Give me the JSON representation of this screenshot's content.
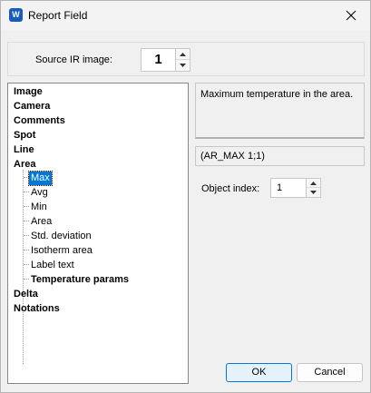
{
  "window": {
    "title": "Report Field",
    "app_icon_letter": "W",
    "icons": {
      "app": "word-app-icon",
      "close": "close-icon"
    }
  },
  "source": {
    "label": "Source IR image:",
    "value": "1"
  },
  "tree": {
    "items": [
      {
        "label": "Image",
        "bold": true
      },
      {
        "label": "Camera",
        "bold": true
      },
      {
        "label": "Comments",
        "bold": true
      },
      {
        "label": "Spot",
        "bold": true
      },
      {
        "label": "Line",
        "bold": true
      },
      {
        "label": "Area",
        "bold": true
      },
      {
        "label": "Max",
        "bold": false,
        "selected": true
      },
      {
        "label": "Avg",
        "bold": false
      },
      {
        "label": "Min",
        "bold": false
      },
      {
        "label": "Area",
        "bold": false
      },
      {
        "label": "Std. deviation",
        "bold": false
      },
      {
        "label": "Isotherm area",
        "bold": false
      },
      {
        "label": "Label text",
        "bold": false
      },
      {
        "label": "Temperature params",
        "bold": true
      },
      {
        "label": "Delta",
        "bold": true
      },
      {
        "label": "Notations",
        "bold": true
      }
    ]
  },
  "details": {
    "description": "Maximum temperature in the area.",
    "formula": "(AR_MAX 1;1)",
    "object_index_label": "Object index:",
    "object_index_value": "1"
  },
  "buttons": {
    "ok": "OK",
    "cancel": "Cancel"
  },
  "colors": {
    "selection": "#0078d7",
    "app_icon": "#185abd",
    "ok_border": "#0078d7"
  }
}
